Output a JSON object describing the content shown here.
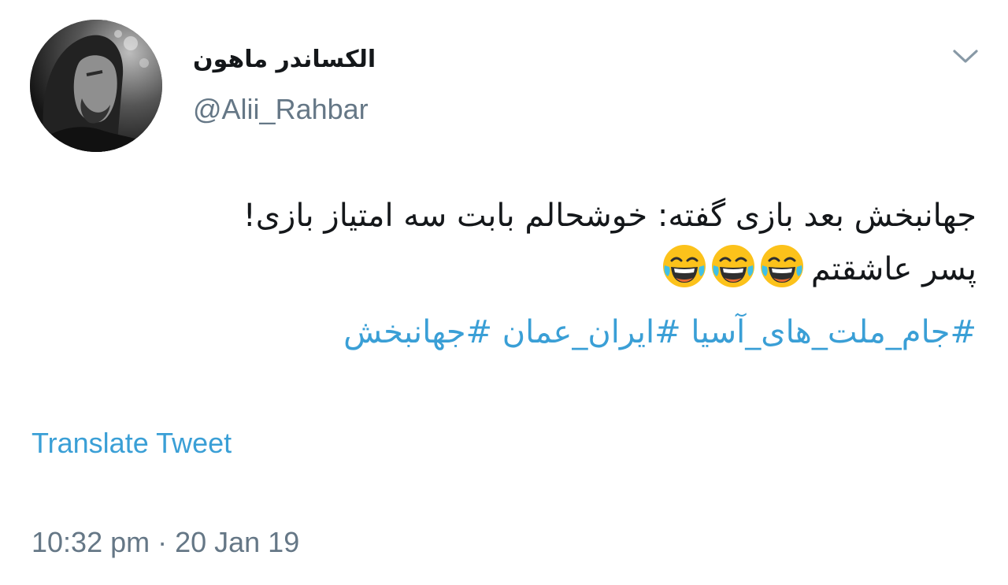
{
  "user": {
    "display_name": "الکساندر ماهون",
    "handle": "@Alii_Rahbar"
  },
  "tweet": {
    "line1": "جهانبخش بعد بازی گفته: خوشحالم بابت سه امتیاز بازی!",
    "line2": "پسر عاشقتم",
    "emoji": "face-with-tears-of-joy",
    "emoji_count": 3,
    "hashtags": [
      "#جام_ملت_های_آسیا",
      "#ایران_عمان",
      "#جهانبخش"
    ]
  },
  "translate_label": "Translate Tweet",
  "timestamp": "10:32 pm · 20 Jan 19",
  "icons": {
    "caret": "chevron-down-icon"
  },
  "colors": {
    "link": "#3a9fd6",
    "text": "#14171a",
    "muted": "#657786"
  }
}
